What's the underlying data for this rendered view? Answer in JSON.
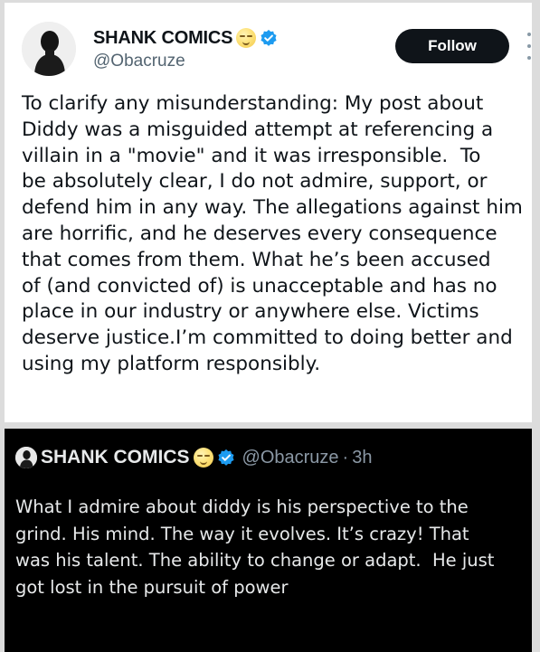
{
  "post": {
    "author_name": "SHANK COMICS",
    "author_handle": "@Obacruze",
    "follow_label": "Follow",
    "text_lines": [
      "To clarify any misunderstanding: My post about",
      "Diddy was a misguided attempt at referencing a",
      "villain in a \"movie\" and it was irresponsible.  To",
      "be absolutely clear, I do not admire, support, or",
      "defend him in any way. The allegations against him",
      "are horrific, and he deserves every consequence",
      "that comes from them. What he’s been accused",
      "of (and convicted of) is unacceptable and has no",
      "place in our industry or anywhere else. Victims",
      "deserve justice.I’m committed to doing better and",
      "using my platform responsibly."
    ]
  },
  "quoted": {
    "author_name": "SHANK COMICS",
    "author_handle": "@Obacruze",
    "separator": "·",
    "time": "3h",
    "text_lines": [
      "What I admire about diddy is his perspective to the",
      "grind. His mind. The way it evolves. It’s crazy! That",
      "was his talent. The ability to change or adapt.  He just",
      "got lost in the pursuit of power"
    ]
  },
  "icons": {
    "verified": "verified-badge-icon",
    "emoji": "relieved-face-emoji-icon",
    "more": "more-options-icon"
  },
  "colors": {
    "verified_blue": "#1d9bf0",
    "follow_bg": "#0f1419",
    "dark_bg": "#000000"
  }
}
